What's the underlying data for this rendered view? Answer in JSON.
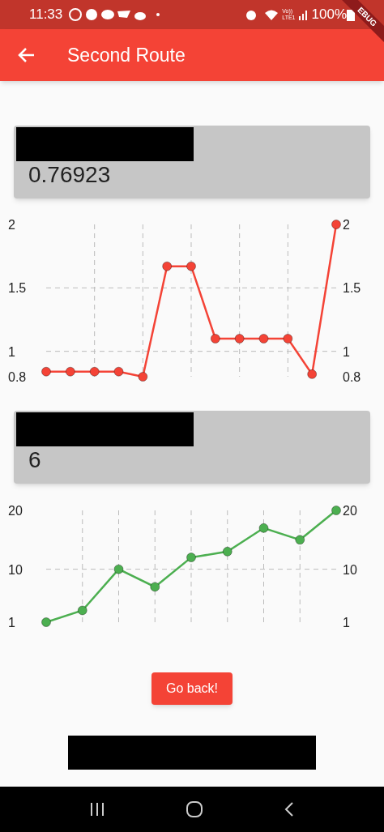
{
  "status_bar": {
    "time": "11:33",
    "network": "Vo))\nLTE1",
    "battery": "100%"
  },
  "debug_banner": "EBUG",
  "app_bar": {
    "title": "Second Route"
  },
  "cards": [
    {
      "value": "0.76923",
      "right_axis_labels": [
        "2",
        "1.5",
        "1",
        "0.8"
      ],
      "chart_data": {
        "type": "line",
        "ylim": [
          0.8,
          2
        ],
        "yticks": [
          0.8,
          1,
          1.5,
          2
        ],
        "grid": true,
        "series": [
          {
            "color": "#f44336",
            "marker": "circle",
            "values": [
              0.84,
              0.84,
              0.84,
              0.84,
              0.8,
              1.67,
              1.67,
              1.1,
              1.1,
              1.1,
              1.1,
              0.82,
              2
            ]
          }
        ]
      }
    },
    {
      "value": "6",
      "right_axis_labels": [
        "20",
        "10",
        "1"
      ],
      "chart_data": {
        "type": "line",
        "ylim": [
          1,
          20
        ],
        "yticks": [
          1,
          10,
          20
        ],
        "grid": true,
        "series": [
          {
            "color": "#4caf50",
            "marker": "circle",
            "values": [
              1,
              3,
              10,
              7,
              12,
              13,
              17,
              15,
              20
            ]
          }
        ]
      }
    }
  ],
  "button": "Go back!"
}
